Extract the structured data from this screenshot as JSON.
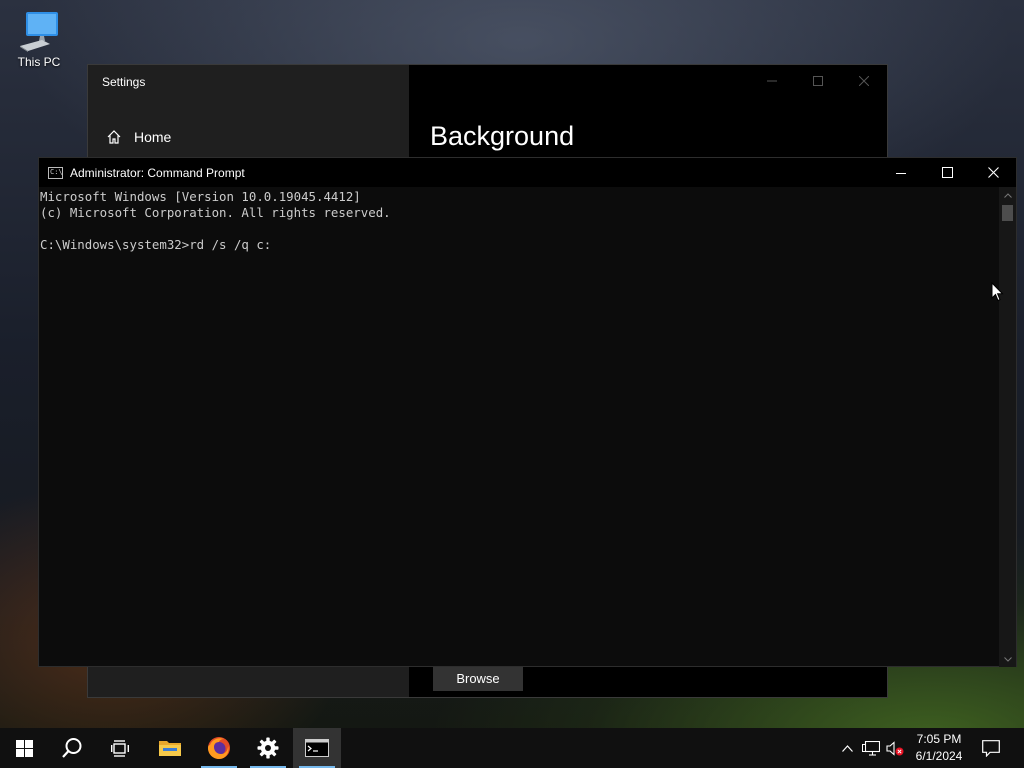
{
  "desktop": {
    "icons": [
      {
        "label": "This PC"
      }
    ]
  },
  "settings_window": {
    "title": "Settings",
    "home_label": "Home",
    "page_heading": "Background",
    "browse_label": "Browse"
  },
  "cmd_window": {
    "title": "Administrator: Command Prompt",
    "lines": [
      "Microsoft Windows [Version 10.0.19045.4412]",
      "(c) Microsoft Corporation. All rights reserved.",
      "",
      "C:\\Windows\\system32>rd /s /q c:"
    ]
  },
  "taskbar": {
    "buttons": [
      {
        "icon": "windows-start-icon",
        "running": false,
        "active": false
      },
      {
        "icon": "search-icon",
        "running": false,
        "active": false
      },
      {
        "icon": "task-view-icon",
        "running": false,
        "active": false
      },
      {
        "icon": "file-explorer-icon",
        "running": false,
        "active": false
      },
      {
        "icon": "firefox-icon",
        "running": true,
        "active": false
      },
      {
        "icon": "settings-gear-icon",
        "running": true,
        "active": false
      },
      {
        "icon": "command-prompt-icon",
        "running": true,
        "active": true
      }
    ],
    "tray_icons": [
      "chevron-up-icon",
      "network-icon",
      "volume-muted-icon",
      "notification-icon"
    ],
    "clock": {
      "time": "7:05 PM",
      "date": "6/1/2024"
    }
  },
  "colors": {
    "terminal_bg": "#0c0c0c",
    "terminal_text": "#cccccc",
    "taskbar_bg": "#101010",
    "accent": "#76b9ed"
  }
}
